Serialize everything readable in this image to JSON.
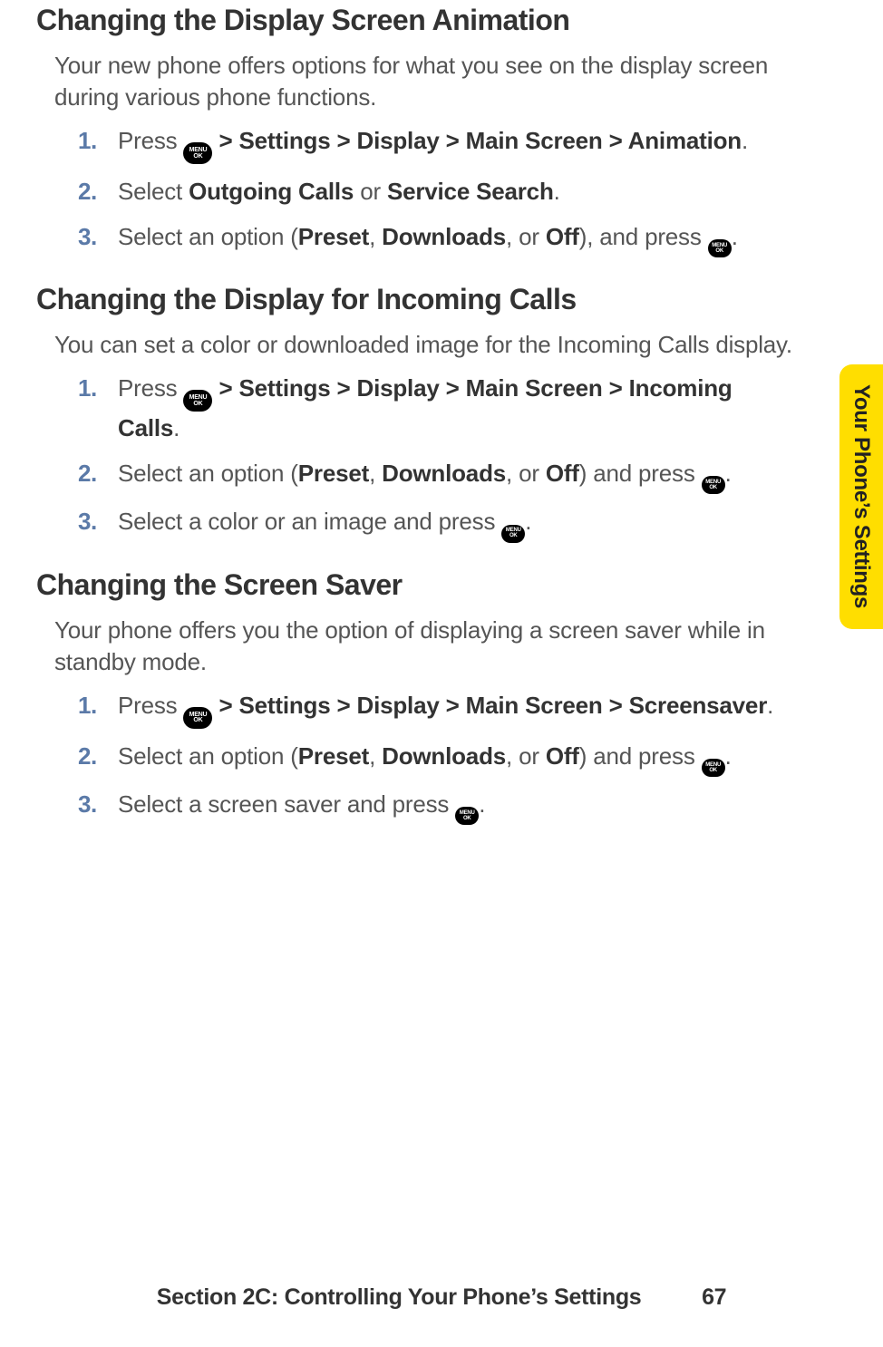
{
  "sections": [
    {
      "heading": "Changing the Display Screen Animation",
      "intro": "Your new phone offers options for what you see on the display screen during various phone functions.",
      "steps": [
        {
          "num": "1.",
          "pre": "Press ",
          "icon": true,
          "post_bold": " > Settings > Display > Main Screen > Animation",
          "tail": "."
        },
        {
          "num": "2.",
          "text_parts": [
            "Select ",
            {
              "b": "Outgoing Calls"
            },
            " or ",
            {
              "b": "Service Search"
            },
            "."
          ]
        },
        {
          "num": "3.",
          "text_parts": [
            "Select an option (",
            {
              "b": "Preset"
            },
            ", ",
            {
              "b": "Downloads"
            },
            ", or ",
            {
              "b": "Off"
            },
            "), and press "
          ],
          "icon_end": true,
          "end": "."
        }
      ]
    },
    {
      "heading": "Changing the Display for Incoming Calls",
      "intro": "You can set a color or downloaded image for the Incoming Calls display.",
      "steps": [
        {
          "num": "1.",
          "pre": "Press ",
          "icon": true,
          "post_bold": " > Settings > Display > Main Screen > Incoming Calls",
          "tail": "."
        },
        {
          "num": "2.",
          "text_parts": [
            "Select an option (",
            {
              "b": "Preset"
            },
            ", ",
            {
              "b": "Downloads"
            },
            ", or ",
            {
              "b": "Off"
            },
            ") and press "
          ],
          "icon_end": true,
          "end": "."
        },
        {
          "num": "3.",
          "text_parts": [
            "Select a color or an image and press "
          ],
          "icon_end": true,
          "end": "."
        }
      ]
    },
    {
      "heading": "Changing the Screen Saver",
      "intro": "Your phone offers you the option of displaying a screen saver while in standby mode.",
      "steps": [
        {
          "num": "1.",
          "pre": "Press ",
          "icon": true,
          "post_bold": " > Settings > Display > Main Screen > Screensaver",
          "tail": "."
        },
        {
          "num": "2.",
          "text_parts": [
            "Select an option (",
            {
              "b": "Preset"
            },
            ", ",
            {
              "b": "Downloads"
            },
            ", or ",
            {
              "b": "Off"
            },
            ") and press "
          ],
          "icon_end": true,
          "end": "."
        },
        {
          "num": "3.",
          "text_parts": [
            "Select a screen saver and press "
          ],
          "icon_end": true,
          "end": "."
        }
      ]
    }
  ],
  "side_tab": "Your Phone’s Settings",
  "footer": {
    "text": "Section 2C: Controlling Your Phone’s Settings",
    "page": "67"
  },
  "icon_label": {
    "top": "MENU",
    "bottom": "OK"
  }
}
